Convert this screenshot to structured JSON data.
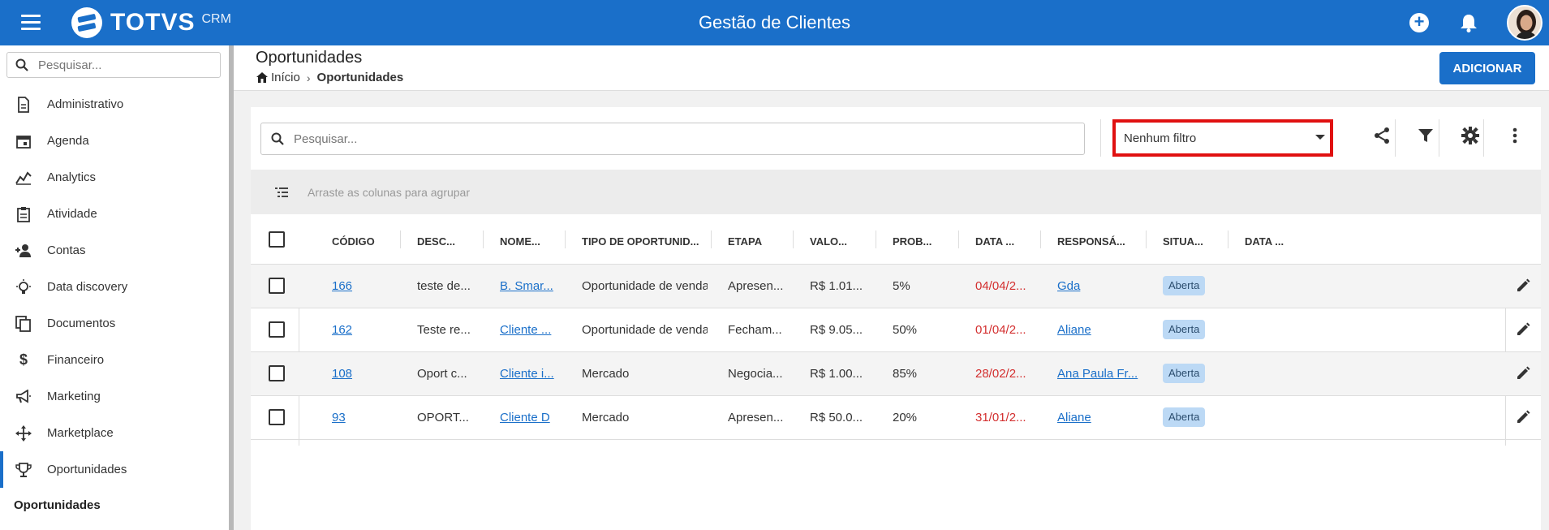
{
  "header": {
    "logo_text": "TOTVS",
    "logo_suffix": "CRM",
    "title": "Gestão de Clientes"
  },
  "sidebar": {
    "search_placeholder": "Pesquisar...",
    "items": [
      {
        "label": "Administrativo",
        "icon": "document-icon"
      },
      {
        "label": "Agenda",
        "icon": "calendar-icon"
      },
      {
        "label": "Analytics",
        "icon": "chart-icon"
      },
      {
        "label": "Atividade",
        "icon": "clipboard-icon"
      },
      {
        "label": "Contas",
        "icon": "add-person-icon"
      },
      {
        "label": "Data discovery",
        "icon": "lightbulb-icon"
      },
      {
        "label": "Documentos",
        "icon": "documents-icon"
      },
      {
        "label": "Financeiro",
        "icon": "dollar-icon"
      },
      {
        "label": "Marketing",
        "icon": "megaphone-icon"
      },
      {
        "label": "Marketplace",
        "icon": "move-arrows-icon"
      },
      {
        "label": "Oportunidades",
        "icon": "trophy-icon"
      }
    ],
    "submenu_label": "Oportunidades"
  },
  "page": {
    "title": "Oportunidades",
    "breadcrumb_home": "Início",
    "breadcrumb_current": "Oportunidades",
    "add_button": "ADICIONAR"
  },
  "grid": {
    "search_placeholder": "Pesquisar...",
    "filter_value": "Nenhum filtro",
    "group_hint": "Arraste as colunas para agrupar",
    "columns": [
      "CÓDIGO",
      "DESC...",
      "NOME...",
      "TIPO DE OPORTUNID...",
      "ETAPA",
      "VALO...",
      "PROB...",
      "DATA ...",
      "RESPONSÁ...",
      "SITUA...",
      "DATA ..."
    ],
    "rows": [
      {
        "codigo": "166",
        "desc": "teste de...",
        "nome": "B. Smar...",
        "tipo": "Oportunidade de venda",
        "etapa": "Apresen...",
        "valor": "R$ 1.01...",
        "prob": "5%",
        "data": "04/04/2...",
        "resp": "Gda",
        "situacao": "Aberta"
      },
      {
        "codigo": "162",
        "desc": "Teste re...",
        "nome": "Cliente ...",
        "tipo": "Oportunidade de venda",
        "etapa": "Fecham...",
        "valor": "R$ 9.05...",
        "prob": "50%",
        "data": "01/04/2...",
        "resp": "Aliane",
        "situacao": "Aberta"
      },
      {
        "codigo": "108",
        "desc": "Oport c...",
        "nome": "Cliente i...",
        "tipo": "Mercado",
        "etapa": "Negocia...",
        "valor": "R$ 1.00...",
        "prob": "85%",
        "data": "28/02/2...",
        "resp": "Ana Paula Fr...",
        "situacao": "Aberta"
      },
      {
        "codigo": "93",
        "desc": "OPORT...",
        "nome": "Cliente D",
        "tipo": "Mercado",
        "etapa": "Apresen...",
        "valor": "R$ 50.0...",
        "prob": "20%",
        "data": "31/01/2...",
        "resp": "Aliane",
        "situacao": "Aberta"
      }
    ]
  },
  "colors": {
    "brand": "#1a6fc9",
    "highlight_border": "#e01010",
    "date_red": "#d32f2f",
    "badge_bg": "#bcd9f5"
  }
}
